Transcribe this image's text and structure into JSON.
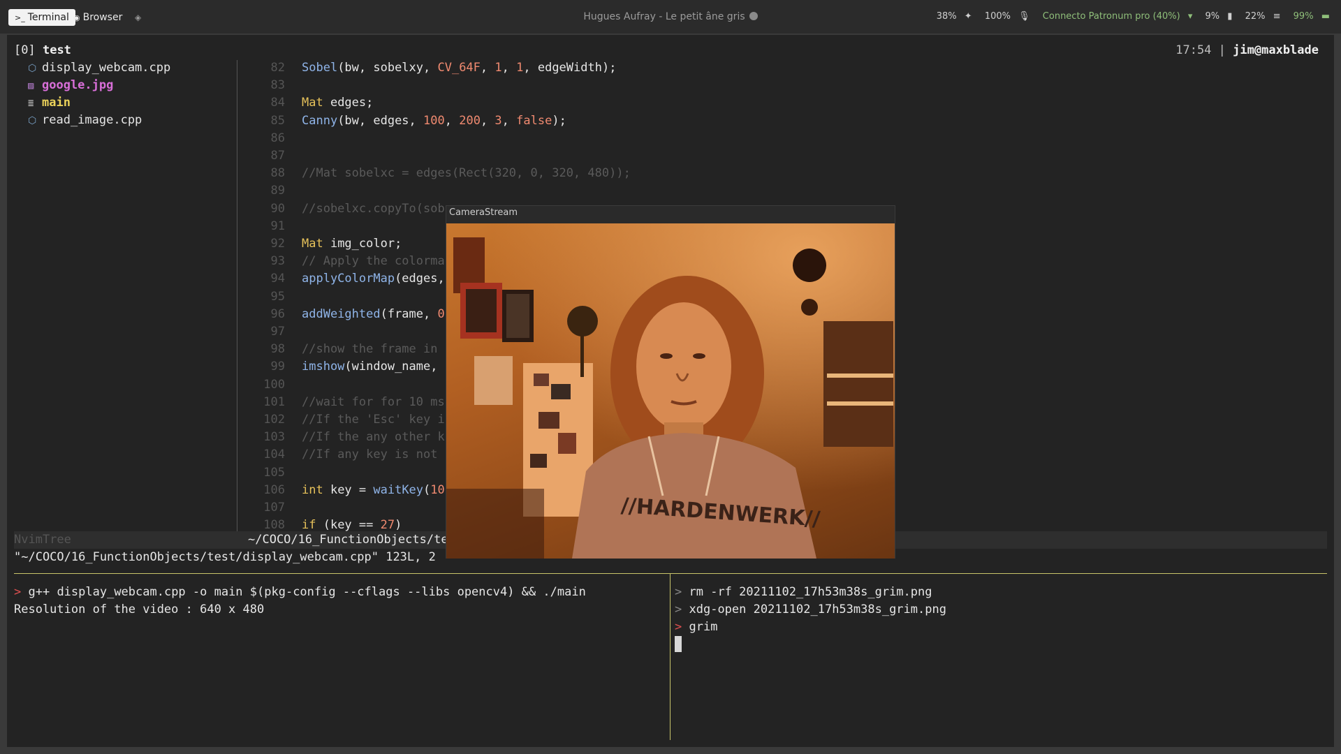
{
  "topbar": {
    "tabs": [
      {
        "label": "Terminal",
        "icon": "terminal-icon",
        "active": true
      },
      {
        "label": "Browser",
        "icon": "globe-icon",
        "active": false
      }
    ],
    "now_playing": "Hugues Aufray - Le petit âne gris",
    "status": {
      "brightness": "38%",
      "volume": "100%",
      "network": "Connecto Patronum pro (40%)",
      "cpu": "9%",
      "memory": "22%",
      "battery": "99%"
    }
  },
  "tree": {
    "session": "[0]",
    "title": "test",
    "files": [
      {
        "name": "display_webcam.cpp",
        "icon": "cpp-file-icon",
        "kind": "cpp"
      },
      {
        "name": "google.jpg",
        "icon": "image-file-icon",
        "kind": "img"
      },
      {
        "name": "main",
        "icon": "binary-file-icon",
        "kind": "exe"
      },
      {
        "name": "read_image.cpp",
        "icon": "cpp-file-icon",
        "kind": "cpp"
      }
    ]
  },
  "header_right": {
    "time": "17:54",
    "separator": "|",
    "user": "jim@maxblade"
  },
  "editor": {
    "lines": [
      {
        "n": "82",
        "segs": [
          [
            "fn",
            "Sobel"
          ],
          [
            "pl",
            "(bw, sobelxy, "
          ],
          [
            "cst",
            "CV_64F"
          ],
          [
            "pl",
            ", "
          ],
          [
            "num",
            "1"
          ],
          [
            "pl",
            ", "
          ],
          [
            "num",
            "1"
          ],
          [
            "pl",
            ", edgeWidth);"
          ]
        ]
      },
      {
        "n": "83",
        "segs": []
      },
      {
        "n": "84",
        "segs": [
          [
            "kw",
            "Mat"
          ],
          [
            "pl",
            " edges;"
          ]
        ]
      },
      {
        "n": "85",
        "segs": [
          [
            "fn",
            "Canny"
          ],
          [
            "pl",
            "(bw, edges, "
          ],
          [
            "num",
            "100"
          ],
          [
            "pl",
            ", "
          ],
          [
            "num",
            "200"
          ],
          [
            "pl",
            ", "
          ],
          [
            "num",
            "3"
          ],
          [
            "pl",
            ", "
          ],
          [
            "cst",
            "false"
          ],
          [
            "pl",
            ");"
          ]
        ]
      },
      {
        "n": "86",
        "segs": []
      },
      {
        "n": "87",
        "segs": []
      },
      {
        "n": "88",
        "segs": [
          [
            "cm",
            "//Mat sobelxc = edges(Rect(320, 0, 320, 480));"
          ]
        ]
      },
      {
        "n": "89",
        "segs": []
      },
      {
        "n": "90",
        "segs": [
          [
            "cm",
            "//sobelxc.copyTo(sob"
          ]
        ]
      },
      {
        "n": "91",
        "segs": []
      },
      {
        "n": "92",
        "segs": [
          [
            "kw",
            "Mat"
          ],
          [
            "pl",
            " img_color;"
          ]
        ]
      },
      {
        "n": "93",
        "segs": [
          [
            "cm",
            "// Apply the colorma"
          ]
        ]
      },
      {
        "n": "94",
        "segs": [
          [
            "fn",
            "applyColorMap"
          ],
          [
            "pl",
            "(edges,"
          ]
        ]
      },
      {
        "n": "95",
        "segs": []
      },
      {
        "n": "96",
        "segs": [
          [
            "fn",
            "addWeighted"
          ],
          [
            "pl",
            "(frame, "
          ],
          [
            "num",
            "0"
          ]
        ]
      },
      {
        "n": "97",
        "segs": []
      },
      {
        "n": "98",
        "segs": [
          [
            "cm",
            "//show the frame in"
          ]
        ]
      },
      {
        "n": "99",
        "segs": [
          [
            "fn",
            "imshow"
          ],
          [
            "pl",
            "(window_name,"
          ]
        ]
      },
      {
        "n": "100",
        "segs": []
      },
      {
        "n": "101",
        "segs": [
          [
            "cm",
            "//wait for for 10 ms"
          ]
        ]
      },
      {
        "n": "102",
        "segs": [
          [
            "cm",
            "//If the 'Esc' key i"
          ]
        ]
      },
      {
        "n": "103",
        "segs": [
          [
            "cm",
            "//If the any other k"
          ]
        ]
      },
      {
        "n": "104",
        "segs": [
          [
            "cm",
            "//If any key is not"
          ]
        ]
      },
      {
        "n": "105",
        "segs": []
      },
      {
        "n": "106",
        "segs": [
          [
            "kw",
            "int"
          ],
          [
            "pl",
            " key = "
          ],
          [
            "fn",
            "waitKey"
          ],
          [
            "pl",
            "("
          ],
          [
            "num",
            "10"
          ]
        ]
      },
      {
        "n": "107",
        "segs": []
      },
      {
        "n": "108",
        "segs": [
          [
            "kw",
            "if"
          ],
          [
            "pl",
            " (key == "
          ],
          [
            "num",
            "27"
          ],
          [
            "pl",
            ")"
          ]
        ]
      }
    ]
  },
  "statusline": {
    "left": "NvimTree",
    "path": "~/COCO/16_FunctionObjects/te"
  },
  "cmdline": "\"~/COCO/16_FunctionObjects/test/display_webcam.cpp\" 123L, 2",
  "pane_left": {
    "prompt": ">",
    "command": "g++ display_webcam.cpp -o main $(pkg-config --cflags --libs opencv4) && ./main",
    "output": "Resolution of the video : 640 x 480"
  },
  "pane_right": {
    "history": [
      {
        "prompt": ">",
        "cmd": "rm -rf 20211102_17h53m38s_grim.png"
      },
      {
        "prompt": ">",
        "cmd": "xdg-open 20211102_17h53m38s_grim.png"
      },
      {
        "prompt": ">",
        "cmd": "grim"
      }
    ]
  },
  "camera": {
    "title": "CameraStream",
    "shirt_text": "//HARDENWERK//"
  }
}
